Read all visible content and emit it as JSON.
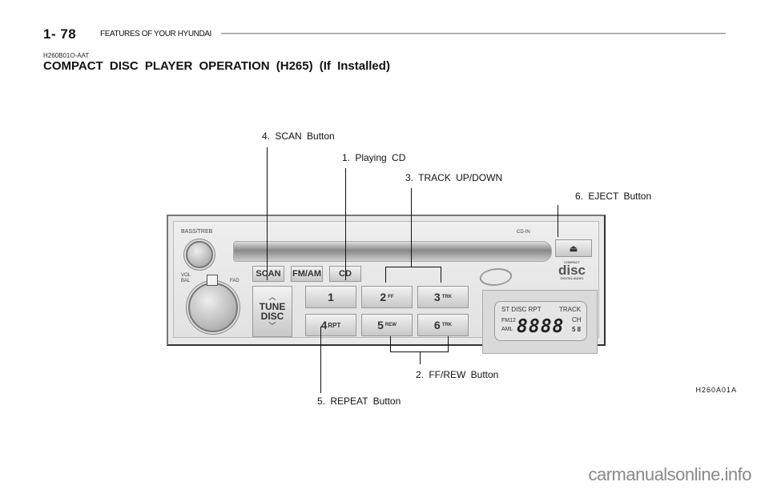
{
  "header": {
    "page_number": "1- 78",
    "section_name": "FEATURES OF YOUR HYUNDAI"
  },
  "section": {
    "code": "H260B01O-AAT",
    "title": "COMPACT DISC PLAYER OPERATION (H265) (If Installed)"
  },
  "callouts": {
    "scan": "4. SCAN Button",
    "playing_cd": "1. Playing CD",
    "track": "3. TRACK  UP/DOWN",
    "eject": "6. EJECT Button",
    "ff_rew": "2. FF/REW Button",
    "repeat": "5. REPEAT Button"
  },
  "radio": {
    "bass_treb": "BASS/TREB",
    "vol": "VOL",
    "bal": "BAL",
    "fad": "FAD",
    "cd_in": "CD-IN",
    "scan": "SCAN",
    "fm_am": "FM/AM",
    "cd": "CD",
    "tune": "TUNE",
    "disc": "DISC",
    "eject_icon": "⏏",
    "presets": [
      {
        "num": "1",
        "sub": ""
      },
      {
        "num": "2",
        "sub": "FF"
      },
      {
        "num": "3",
        "sub": "TRK"
      },
      {
        "num": "4",
        "sub": "RPT"
      },
      {
        "num": "5",
        "sub": "REW"
      },
      {
        "num": "6",
        "sub": "TRK"
      }
    ],
    "disc_logo": "disc",
    "disc_logo_top": "COMPACT",
    "disc_logo_bottom": "DIGITAL AUDIO",
    "lcd": {
      "top_row": "ST DISC RPT",
      "track": "TRACK",
      "fm": "FM12",
      "am": "AML",
      "digits": "8888",
      "ch": "CH",
      "small": "5 8"
    }
  },
  "figure_id": "H260A01A",
  "watermark": "carmanualsonline.info"
}
